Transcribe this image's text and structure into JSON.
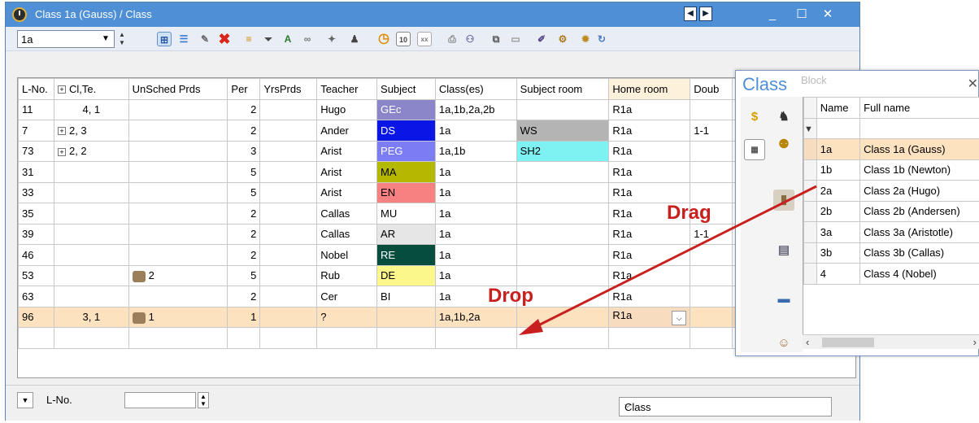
{
  "window": {
    "title": "Class 1a (Gauss) / Class",
    "minimize_glyph": "_",
    "maximize_glyph": "☐",
    "close_glyph": "✕"
  },
  "toolbar": {
    "element_select_value": "1a"
  },
  "grid": {
    "columns": [
      "L-No.",
      "Cl,Te.",
      "UnSched Prds",
      "Per",
      "YrsPrds",
      "Teacher",
      "Subject",
      "Class(es)",
      "Subject room",
      "Home room",
      "Doub"
    ],
    "rows": [
      {
        "lno": "11",
        "clte": "4, 1",
        "clte_expand": false,
        "unsched": "",
        "per": "2",
        "yrsprds": "",
        "teacher": "Hugo",
        "subject": "GEc",
        "subject_color": "#8b86c9",
        "subject_text_color": "#ffffff",
        "classes": "1a,1b,2a,2b",
        "subject_room": "",
        "subject_room_color": "",
        "home_room": "R1a",
        "doub": ""
      },
      {
        "lno": "7",
        "clte": "2, 3",
        "clte_expand": true,
        "unsched": "",
        "per": "2",
        "yrsprds": "",
        "teacher": "Ander",
        "subject": "DS",
        "subject_color": "#0a16e6",
        "subject_text_color": "#ffffff",
        "classes": "1a",
        "subject_room": "WS",
        "subject_room_color": "#b4b4b4",
        "home_room": "R1a",
        "doub": "1-1"
      },
      {
        "lno": "73",
        "clte": "2, 2",
        "clte_expand": true,
        "unsched": "",
        "per": "3",
        "yrsprds": "",
        "teacher": "Arist",
        "subject": "PEG",
        "subject_color": "#7c7cf5",
        "subject_text_color": "#ffffff",
        "classes": "1a,1b",
        "subject_room": "SH2",
        "subject_room_color": "#7ef2f2",
        "home_room": "R1a",
        "doub": ""
      },
      {
        "lno": "31",
        "clte": "",
        "clte_expand": false,
        "unsched": "",
        "per": "5",
        "yrsprds": "",
        "teacher": "Arist",
        "subject": "MA",
        "subject_color": "#b5b800",
        "subject_text_color": "#000000",
        "classes": "1a",
        "subject_room": "",
        "subject_room_color": "",
        "home_room": "R1a",
        "doub": ""
      },
      {
        "lno": "33",
        "clte": "",
        "clte_expand": false,
        "unsched": "",
        "per": "5",
        "yrsprds": "",
        "teacher": "Arist",
        "subject": "EN",
        "subject_color": "#f78080",
        "subject_text_color": "#000000",
        "classes": "1a",
        "subject_room": "",
        "subject_room_color": "",
        "home_room": "R1a",
        "doub": ""
      },
      {
        "lno": "35",
        "clte": "",
        "clte_expand": false,
        "unsched": "",
        "per": "2",
        "yrsprds": "",
        "teacher": "Callas",
        "subject": "MU",
        "subject_color": "#ffffff",
        "subject_text_color": "#000000",
        "classes": "1a",
        "subject_room": "",
        "subject_room_color": "",
        "home_room": "R1a",
        "doub": ""
      },
      {
        "lno": "39",
        "clte": "",
        "clte_expand": false,
        "unsched": "",
        "per": "2",
        "yrsprds": "",
        "teacher": "Callas",
        "subject": "AR",
        "subject_color": "#e6e6e6",
        "subject_text_color": "#000000",
        "classes": "1a",
        "subject_room": "",
        "subject_room_color": "",
        "home_room": "R1a",
        "doub": "1-1"
      },
      {
        "lno": "46",
        "clte": "",
        "clte_expand": false,
        "unsched": "",
        "per": "2",
        "yrsprds": "",
        "teacher": "Nobel",
        "subject": "RE",
        "subject_color": "#074d3d",
        "subject_text_color": "#ffffff",
        "classes": "1a",
        "subject_room": "",
        "subject_room_color": "",
        "home_room": "R1a",
        "doub": ""
      },
      {
        "lno": "53",
        "clte": "",
        "clte_expand": false,
        "unsched": "2",
        "per": "5",
        "yrsprds": "",
        "teacher": "Rub",
        "subject": "DE",
        "subject_color": "#fcf78a",
        "subject_text_color": "#000000",
        "classes": "1a",
        "subject_room": "",
        "subject_room_color": "",
        "home_room": "R1a",
        "doub": ""
      },
      {
        "lno": "63",
        "clte": "",
        "clte_expand": false,
        "unsched": "",
        "per": "2",
        "yrsprds": "",
        "teacher": "Cer",
        "subject": "BI",
        "subject_color": "#ffffff",
        "subject_text_color": "#000000",
        "classes": "1a",
        "subject_room": "",
        "subject_room_color": "",
        "home_room": "R1a",
        "doub": ""
      },
      {
        "lno": "96",
        "clte": "3, 1",
        "clte_expand": false,
        "unsched": "1",
        "per": "1",
        "yrsprds": "",
        "teacher": "?",
        "subject": "",
        "subject_color": "",
        "subject_text_color": "#000000",
        "classes": "1a,1b,2a",
        "subject_room": "",
        "subject_room_color": "",
        "home_room": "R1a",
        "doub": "",
        "selected": true
      }
    ]
  },
  "status": {
    "sort_label": "L-No.",
    "sort_value": "",
    "view_select_value": "Class"
  },
  "class_popup": {
    "title": "Class",
    "ghost_text": "Block",
    "columns": [
      "Name",
      "Full name"
    ],
    "rows": [
      {
        "name": "1a",
        "full": "Class 1a (Gauss)",
        "selected": true
      },
      {
        "name": "1b",
        "full": "Class 1b (Newton)"
      },
      {
        "name": "2a",
        "full": "Class 2a (Hugo)"
      },
      {
        "name": "2b",
        "full": "Class 2b (Andersen)"
      },
      {
        "name": "3a",
        "full": "Class 3a (Aristotle)"
      },
      {
        "name": "3b",
        "full": "Class 3b (Callas)"
      },
      {
        "name": "4",
        "full": "Class 4 (Nobel)"
      }
    ]
  },
  "annotations": {
    "drag": "Drag",
    "drop": "Drop",
    "color": "#c8201e"
  },
  "icons": [
    "clock-icon",
    "close-icon",
    "filter-icon",
    "dollar-icon",
    "graduation-cap-icon",
    "people-icon",
    "calendar-icon",
    "door-icon",
    "book-icon",
    "person-icon"
  ]
}
